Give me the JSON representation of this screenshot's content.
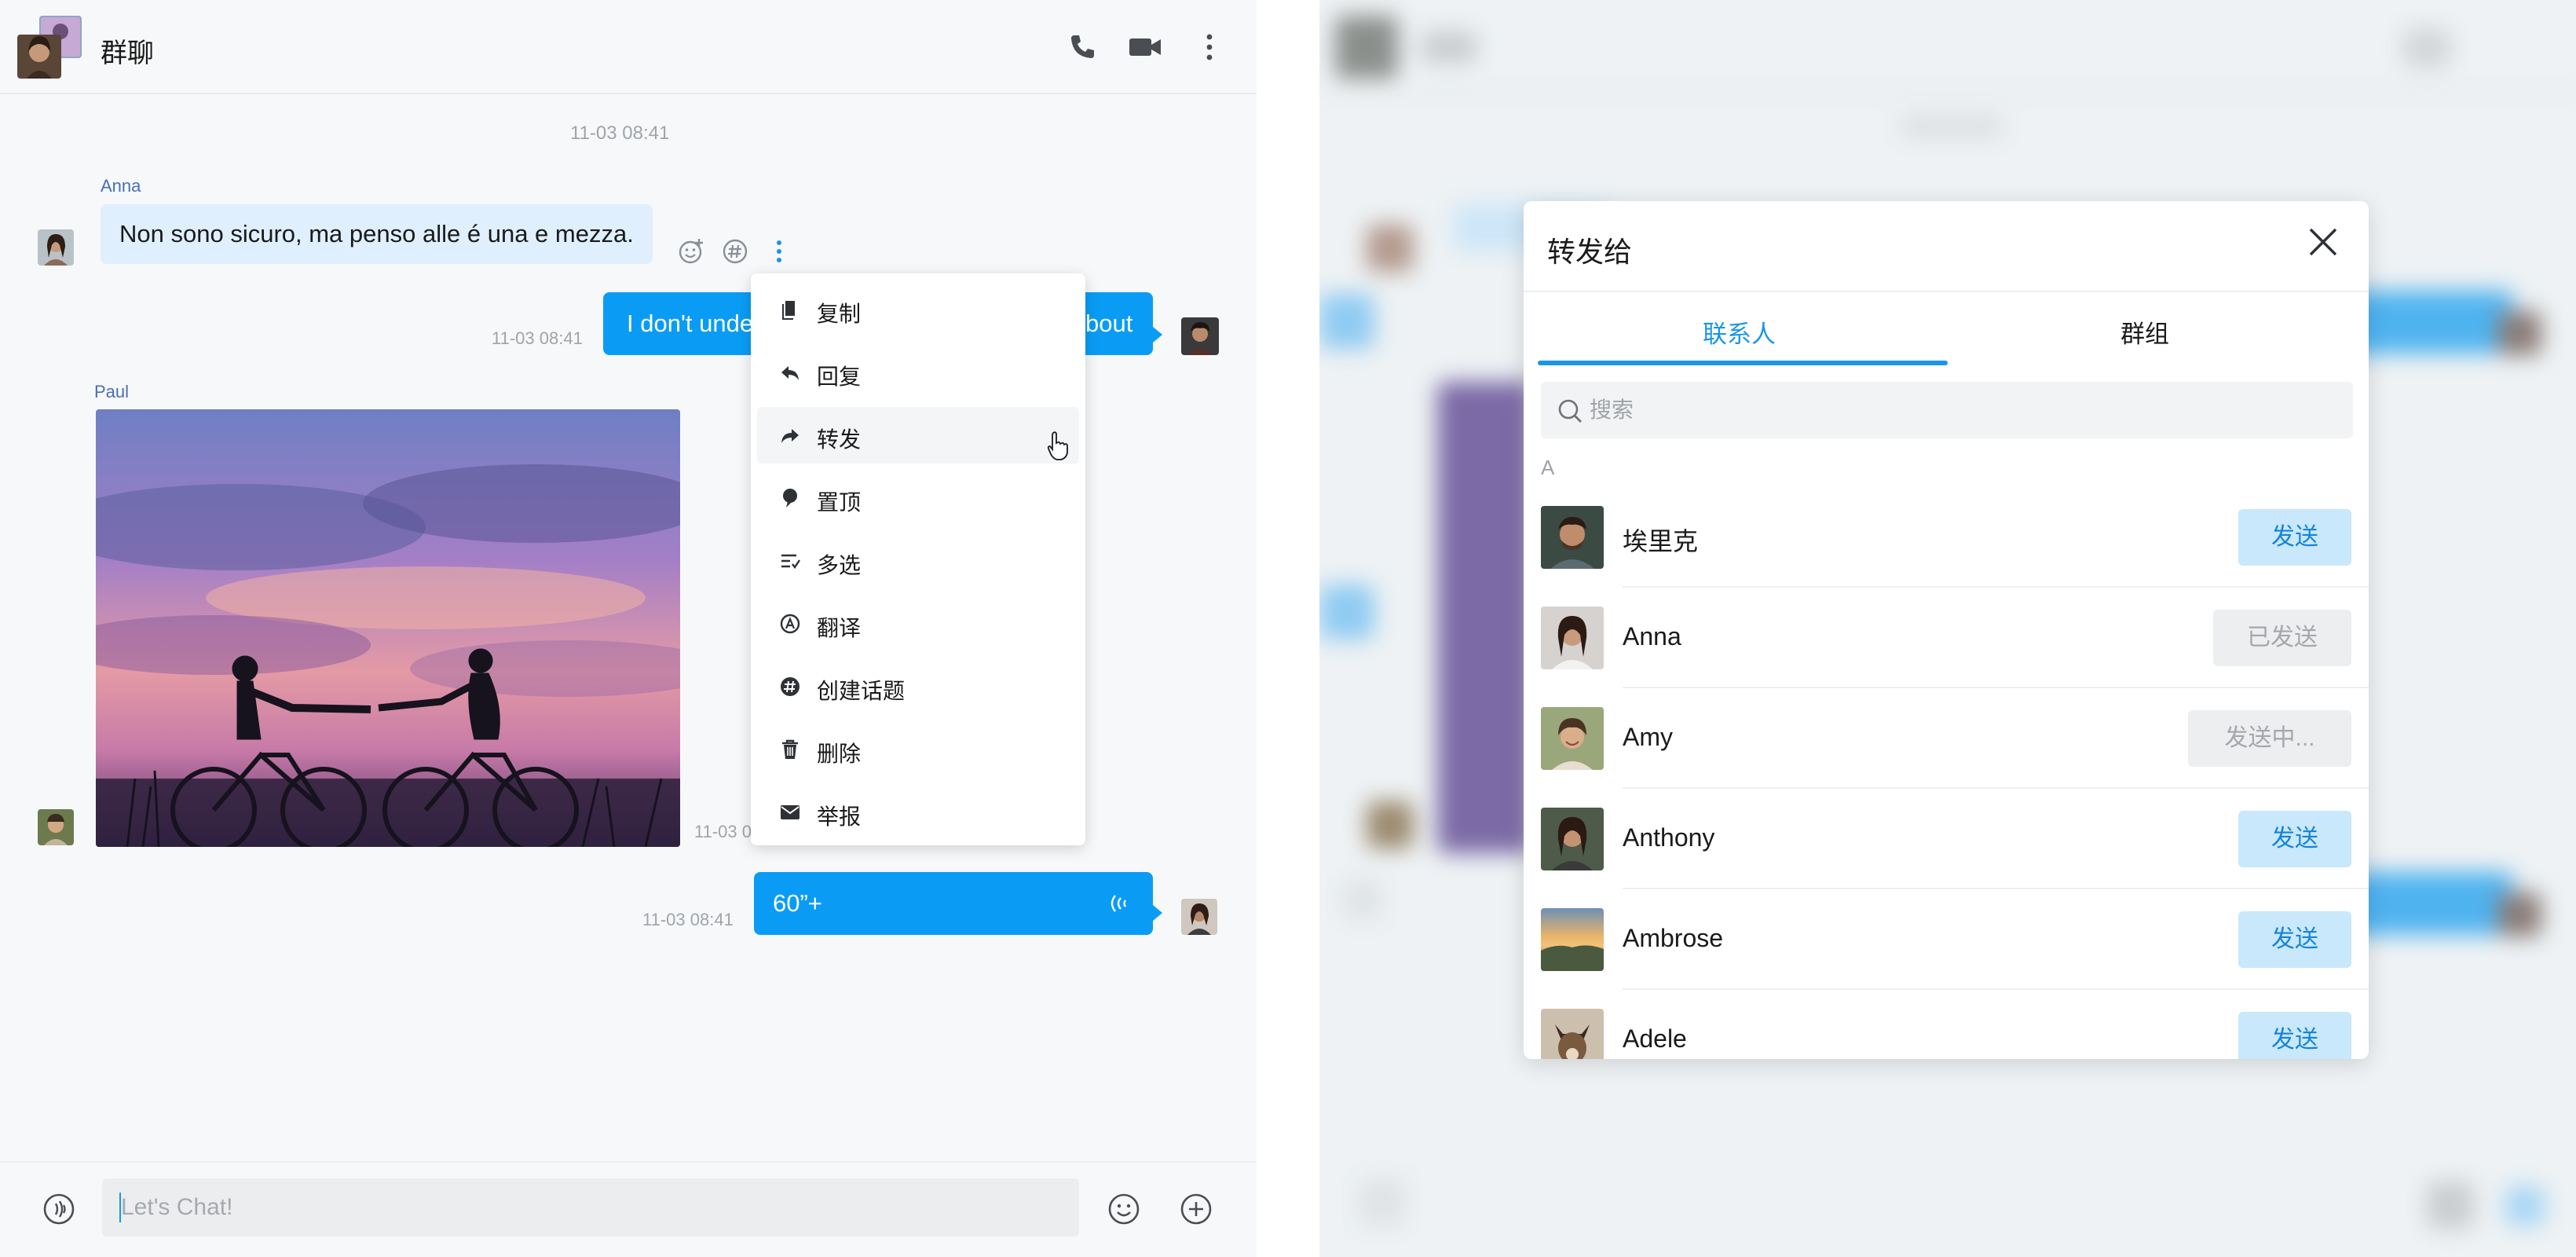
{
  "chat": {
    "title": "群聊",
    "date_header": "11-03 08:41",
    "messages": [
      {
        "sender": "Anna",
        "text": "Non sono sicuro, ma penso alle é una e mezza."
      },
      {
        "time": "11-03 08:41",
        "text_start": "I don't unde",
        "text_end": "bout"
      },
      {
        "sender": "Paul",
        "time": "11-03 0"
      },
      {
        "time": "11-03 08:41",
        "text": "60”+"
      }
    ],
    "input_placeholder": "Let's Chat!"
  },
  "context_menu": {
    "items": [
      {
        "label": "复制",
        "icon": "copy-icon"
      },
      {
        "label": "回复",
        "icon": "reply-icon"
      },
      {
        "label": "转发",
        "icon": "forward-icon"
      },
      {
        "label": "置顶",
        "icon": "pin-icon"
      },
      {
        "label": "多选",
        "icon": "multi-select-icon"
      },
      {
        "label": "翻译",
        "icon": "translate-icon"
      },
      {
        "label": "创建话题",
        "icon": "topic-icon"
      },
      {
        "label": "删除",
        "icon": "trash-icon"
      },
      {
        "label": "举报",
        "icon": "mail-icon"
      }
    ],
    "hovered": "转发"
  },
  "forward_dialog": {
    "title": "转发给",
    "tabs": [
      "联系人",
      "群组"
    ],
    "active_tab": "联系人",
    "search_placeholder": "搜索",
    "section_letter": "A",
    "contacts": [
      {
        "name": "埃里克",
        "action": "发送",
        "state": "send"
      },
      {
        "name": "Anna",
        "action": "已发送",
        "state": "sent"
      },
      {
        "name": "Amy",
        "action": "发送中...",
        "state": "sending"
      },
      {
        "name": "Anthony",
        "action": "发送",
        "state": "send"
      },
      {
        "name": "Ambrose",
        "action": "发送",
        "state": "send"
      },
      {
        "name": "Adele",
        "action": "发送",
        "state": "send"
      }
    ]
  },
  "colors": {
    "accent": "#0a9cf5",
    "incoming_bubble": "#dfeffd",
    "send_button_bg": "#c9e8fb",
    "send_button_text": "#1584d8",
    "disabled_button_bg": "#edeef0"
  }
}
